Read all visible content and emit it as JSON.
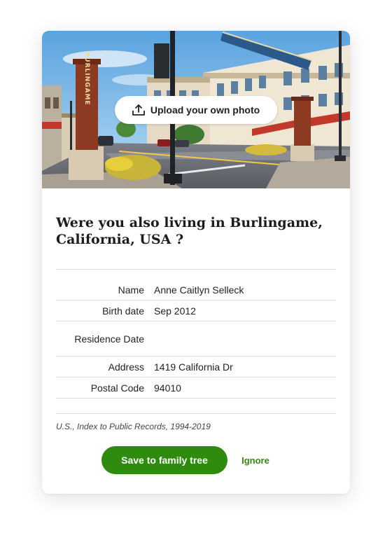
{
  "hero": {
    "upload_label": "Upload your own photo",
    "pillar_text": "BURLINGAME"
  },
  "question": "Were you also living in Burlingame, California, USA ?",
  "record": {
    "rows": [
      {
        "label": "Name",
        "value": "Anne Caitlyn Selleck"
      },
      {
        "label": "Birth date",
        "value": "Sep 2012"
      },
      {
        "label": "Residence Date",
        "value": ""
      },
      {
        "label": "Address",
        "value": "1419 California Dr"
      },
      {
        "label": "Postal Code",
        "value": "94010"
      }
    ]
  },
  "source": "U.S., Index to Public Records, 1994-2019",
  "actions": {
    "save_label": "Save to family tree",
    "ignore_label": "Ignore"
  },
  "colors": {
    "accent": "#2e8b0e",
    "divider": "#dcdcdc"
  }
}
